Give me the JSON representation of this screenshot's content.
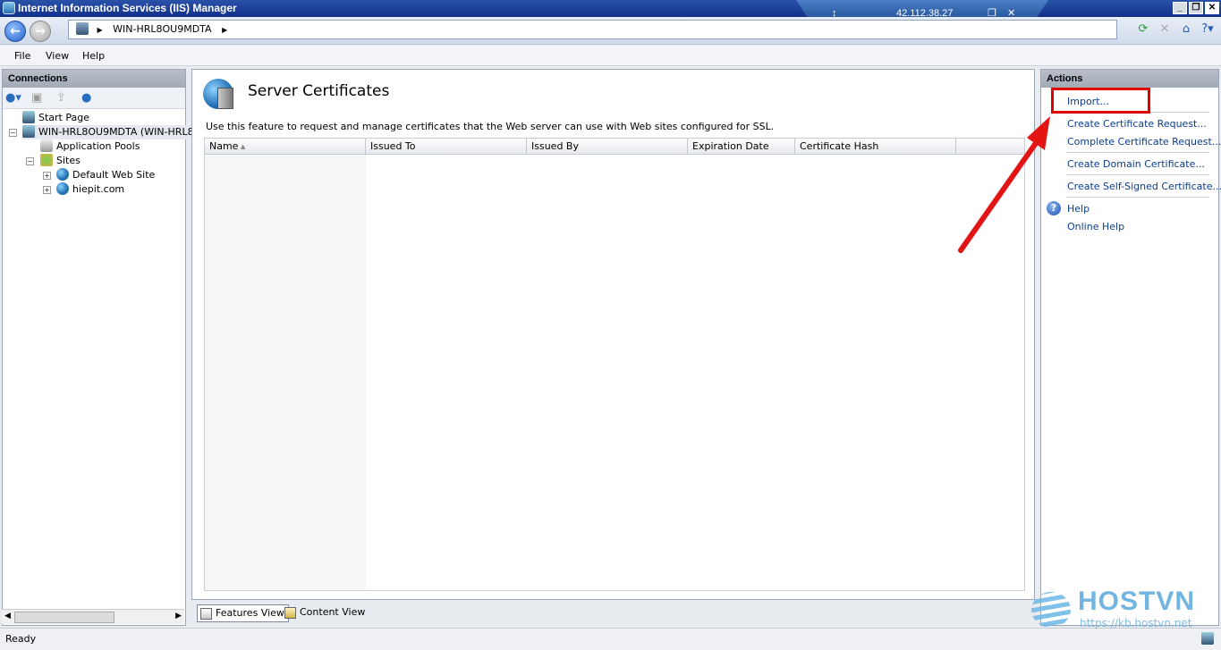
{
  "window": {
    "title": "Internet Information Services (IIS) Manager",
    "rdp_ip": "42.112.38.27",
    "rdp_pin_glyph": "↕",
    "min_glyph": "_",
    "restore_glyph": "❐",
    "close_glyph": "✕"
  },
  "address_bar": {
    "path": "WIN-HRL8OU9MDTA",
    "separator": "▶"
  },
  "menu": {
    "file": "File",
    "view": "View",
    "help": "Help"
  },
  "connections": {
    "header": "Connections",
    "tree": [
      {
        "label": "Start Page"
      },
      {
        "label": "WIN-HRL8OU9MDTA (WIN-HRL8O"
      },
      {
        "label": "Application Pools"
      },
      {
        "label": "Sites"
      },
      {
        "label": "Default Web Site"
      },
      {
        "label": "hiepit.com"
      }
    ]
  },
  "main": {
    "title": "Server Certificates",
    "description": "Use this feature to request and manage certificates that the Web server can use with Web sites configured for SSL.",
    "columns": [
      "Name",
      "Issued To",
      "Issued By",
      "Expiration Date",
      "Certificate Hash"
    ],
    "sort_glyph": "▲",
    "view_tabs": {
      "features": "Features View",
      "content": "Content View"
    }
  },
  "actions": {
    "header": "Actions",
    "items": [
      {
        "label": "Import..."
      },
      {
        "label": "Create Certificate Request..."
      },
      {
        "label": "Complete Certificate Request..."
      },
      {
        "label": "Create Domain Certificate..."
      },
      {
        "label": "Create Self-Signed Certificate..."
      },
      {
        "label": "Help"
      },
      {
        "label": "Online Help"
      }
    ]
  },
  "status": {
    "text": "Ready"
  },
  "watermark": {
    "brand": "HOSTVN",
    "url": "https://kb.hostvn.net"
  },
  "colors": {
    "highlight": "#e00000",
    "arrow": "#e31414",
    "link": "#0b3c8a"
  }
}
